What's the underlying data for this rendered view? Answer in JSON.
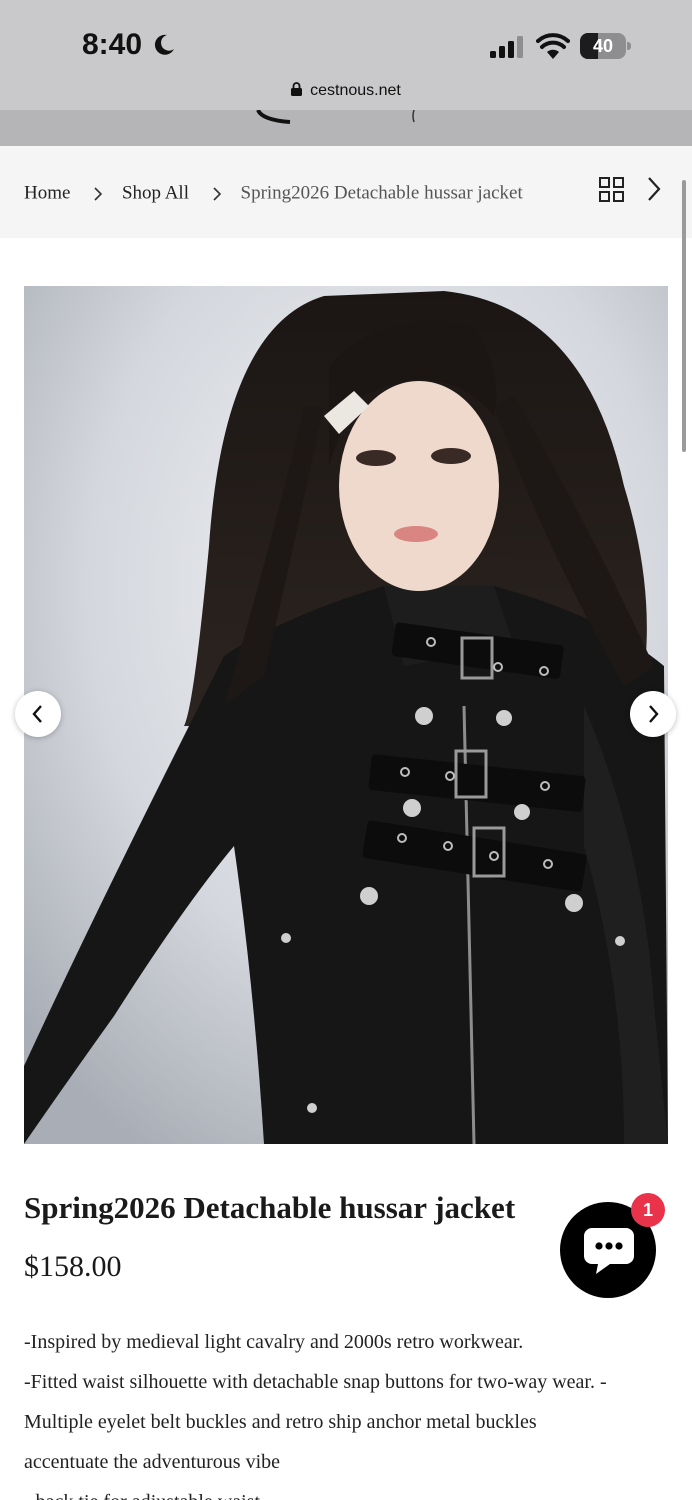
{
  "status_bar": {
    "time": "8:40",
    "battery_level": "40",
    "battery_fraction": 0.4,
    "url": "cestnous.net"
  },
  "breadcrumb": {
    "home": "Home",
    "shop_all": "Shop All",
    "current": "Spring2026 Detachable hussar jacket"
  },
  "product": {
    "title": "Spring2026 Detachable hussar jacket",
    "price": "$158.00",
    "description": [
      "-Inspired by medieval light cavalry and 2000s retro workwear.",
      "-Fitted waist silhouette with detachable snap buttons for two-way wear. -",
      "Multiple eyelet belt buckles and retro ship anchor metal buckles",
      "accentuate the adventurous vibe",
      "- back tie for adjustable waist"
    ]
  },
  "chat": {
    "badge_count": "1"
  },
  "icons": {
    "moon": "moon-icon",
    "signal": "cellular-signal-icon",
    "wifi": "wifi-icon",
    "lock": "lock-icon",
    "grid": "grid-view-icon",
    "chevron_right": "chevron-right-icon",
    "chevron_left": "chevron-left-icon",
    "chat": "chat-icon"
  },
  "colors": {
    "status_bar_bg": "#c9c9cb",
    "breadcrumb_bg": "#f5f5f5",
    "chat_button": "#000000",
    "badge": "#e8334a"
  }
}
